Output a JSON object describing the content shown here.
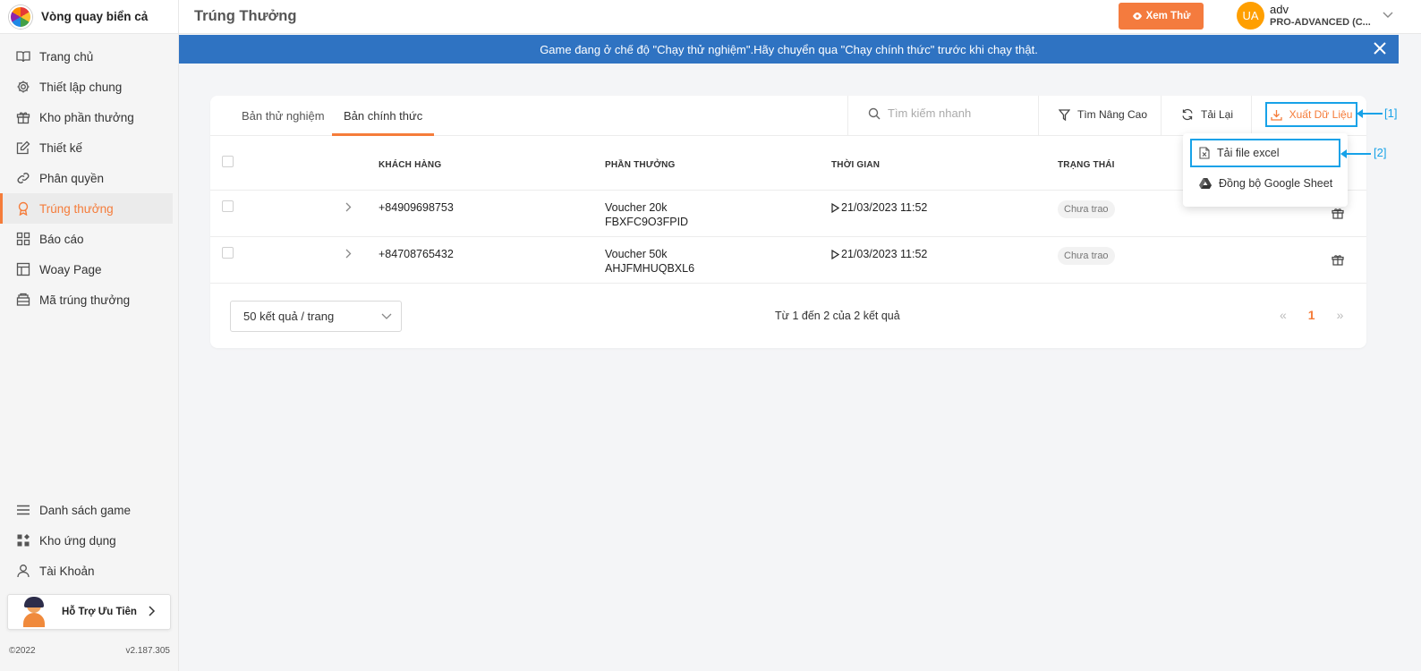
{
  "app": {
    "name": "Vòng quay biển cả"
  },
  "sidebar": {
    "items": [
      {
        "label": "Trang chủ",
        "icon": "book-icon"
      },
      {
        "label": "Thiết lập chung",
        "icon": "gear-icon"
      },
      {
        "label": "Kho phần thưởng",
        "icon": "gift-icon"
      },
      {
        "label": "Thiết kế",
        "icon": "edit-icon"
      },
      {
        "label": "Phân quyền",
        "icon": "link-icon"
      },
      {
        "label": "Trúng thưởng",
        "icon": "award-icon",
        "active": true
      },
      {
        "label": "Báo cáo",
        "icon": "grid-icon"
      },
      {
        "label": "Woay Page",
        "icon": "layout-icon"
      },
      {
        "label": "Mã trúng thưởng",
        "icon": "ticket-icon"
      }
    ],
    "bottom_items": [
      {
        "label": "Danh sách game",
        "icon": "menu-icon"
      },
      {
        "label": "Kho ứng dụng",
        "icon": "apps-icon"
      },
      {
        "label": "Tài Khoản",
        "icon": "user-icon"
      }
    ],
    "support_label": "Hỗ Trợ Ưu Tiên",
    "copyright": "©2022",
    "version": "v2.187.305"
  },
  "header": {
    "title": "Trúng Thưởng",
    "preview_label": "Xem Thử",
    "user": {
      "initials": "UA",
      "name": "adv",
      "plan": "PRO-ADVANCED (C..."
    }
  },
  "banner": {
    "text": "Game đang ở chế độ \"Chạy thử nghiệm\".Hãy chuyển qua \"Chạy chính thức\" trước khi chạy thật."
  },
  "toolbar": {
    "tabs": [
      "Bản thử nghiệm",
      "Bản chính thức"
    ],
    "active_tab": 1,
    "search_placeholder": "Tìm kiếm nhanh",
    "advanced_search": "Tìm Nâng Cao",
    "reload": "Tải Lại",
    "export": "Xuất Dữ Liệu"
  },
  "table": {
    "columns": [
      "KHÁCH HÀNG",
      "PHẦN THƯỞNG",
      "THỜI GIAN",
      "TRẠNG THÁI"
    ],
    "rows": [
      {
        "customer": "+84909698753",
        "reward": "Voucher 20k",
        "code": "FBXFC9O3FPID",
        "time": "21/03/2023 11:52",
        "status": "Chưa trao"
      },
      {
        "customer": "+84708765432",
        "reward": "Voucher 50k",
        "code": "AHJFMHUQBXL6",
        "time": "21/03/2023 11:52",
        "status": "Chưa trao"
      }
    ]
  },
  "pagination": {
    "page_size": "50 kết quả / trang",
    "info": "Từ 1 đến 2 của 2 kết quả",
    "current_page": "1"
  },
  "dropdown": {
    "items": [
      "Tải file excel",
      "Đồng bộ Google Sheet"
    ]
  },
  "annotations": [
    "[1]",
    "[2]"
  ],
  "colors": {
    "accent": "#f57c3a",
    "banner": "#2f73c2",
    "annotation": "#17a2e8",
    "avatar": "#ff9f00"
  }
}
